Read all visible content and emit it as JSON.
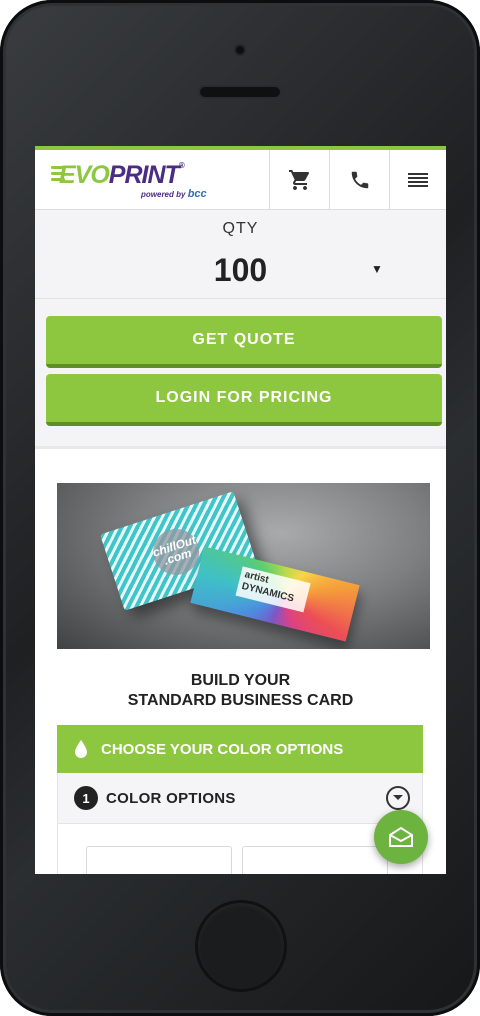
{
  "header": {
    "logo_evo": "EVO",
    "logo_print": "PRINT",
    "logo_sub": "powered by",
    "logo_brand": "bcc"
  },
  "quantity": {
    "label": "QTY",
    "selected": "100"
  },
  "buttons": {
    "get_quote": "GET QUOTE",
    "login_pricing": "LOGIN FOR PRICING"
  },
  "hero": {
    "card1_text": "chillOut .com",
    "card2_text": "artist DYNAMICS"
  },
  "build": {
    "line1": "BUILD YOUR",
    "line2": "STANDARD BUSINESS CARD"
  },
  "color_section": {
    "header": "CHOOSE YOUR COLOR OPTIONS",
    "step_number": "1",
    "step_label": "COLOR OPTIONS"
  },
  "icons": {
    "cart": "cart-icon",
    "phone": "phone-icon",
    "menu": "hamburger-menu-icon",
    "drop": "ink-drop-icon",
    "toggle": "chevron-down-icon",
    "chat": "envelope-icon"
  },
  "colors": {
    "brand_green": "#8dc63f",
    "brand_purple": "#4b2c83"
  }
}
